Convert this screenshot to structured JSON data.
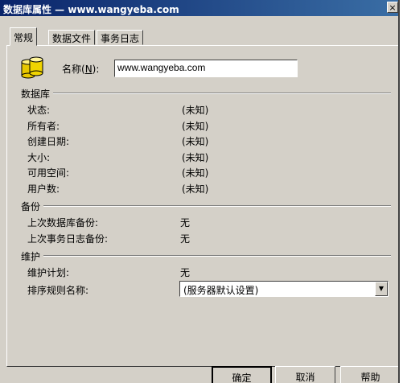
{
  "window": {
    "title": "数据库属性 — www.wangyeba.com",
    "close_glyph": "×"
  },
  "tabs": [
    {
      "label": "常规"
    },
    {
      "label": "数据文件"
    },
    {
      "label": "事务日志"
    }
  ],
  "general": {
    "name_label_pre": "名称(",
    "name_label_key": "N",
    "name_label_post": "):",
    "name_value": "www.wangyeba.com"
  },
  "database_section": {
    "heading": "数据库",
    "rows": [
      {
        "label": "状态:",
        "value": "(未知)"
      },
      {
        "label": "所有者:",
        "value": "(未知)"
      },
      {
        "label": "创建日期:",
        "value": "(未知)"
      },
      {
        "label": "大小:",
        "value": "(未知)"
      },
      {
        "label": "可用空间:",
        "value": "(未知)"
      },
      {
        "label": "用户数:",
        "value": "(未知)"
      }
    ]
  },
  "backup_section": {
    "heading": "备份",
    "rows": [
      {
        "label": "上次数据库备份:",
        "value": "无"
      },
      {
        "label": "上次事务日志备份:",
        "value": "无"
      }
    ]
  },
  "maintenance_section": {
    "heading": "维护",
    "plan_label": "维护计划:",
    "plan_value": "无",
    "collation_label": "排序规则名称:",
    "collation_value": "(服务器默认设置)",
    "dropdown_glyph": "▼"
  },
  "buttons": {
    "ok": "确定",
    "cancel": "取消",
    "help": "帮助"
  },
  "colors": {
    "titlebar": "#0a246a",
    "face": "#d4d0c8"
  }
}
